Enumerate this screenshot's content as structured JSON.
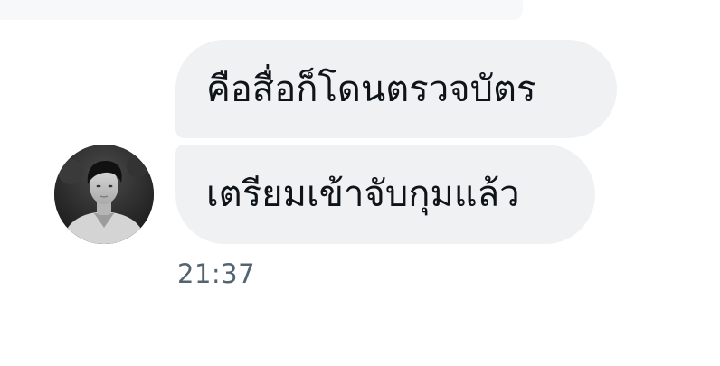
{
  "conversation": {
    "avatar_icon": "user-avatar-photo",
    "messages": [
      {
        "text": "คือสื่อก็โดนตรวจบัตร"
      },
      {
        "text": "เตรียมเข้าจับกุมแล้ว"
      }
    ],
    "timestamp": "21:37"
  },
  "colors": {
    "bubble_background": "#eff1f3",
    "message_text": "#0f1419",
    "timestamp_text": "#536471",
    "page_background": "#ffffff"
  }
}
